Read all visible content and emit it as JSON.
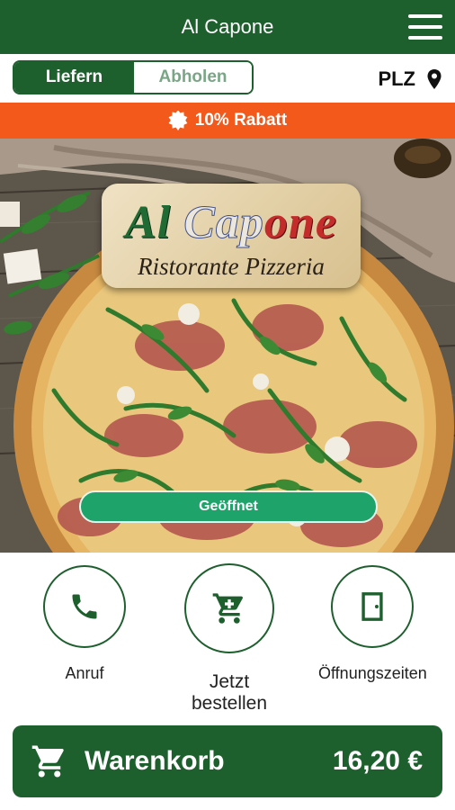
{
  "header": {
    "title": "Al Capone",
    "menu_icon": "hamburger-menu-icon"
  },
  "mode_toggle": {
    "options": [
      "Liefern",
      "Abholen"
    ],
    "selected": "Liefern"
  },
  "postcode": {
    "label": "PLZ",
    "icon": "location-pin-icon"
  },
  "promo": {
    "text": "10% Rabatt",
    "icon": "badge-icon",
    "color": "#f4591c"
  },
  "logo": {
    "word_1": "Al",
    "word_2": "Cap",
    "word_3": "one",
    "subtitle": "Ristorante Pizzeria"
  },
  "status": {
    "text": "Geöffnet",
    "color": "#1ea36a"
  },
  "actions": [
    {
      "label": "Anruf",
      "icon": "phone-icon"
    },
    {
      "label": "Jetzt bestellen",
      "icon": "cart-icon"
    },
    {
      "label": "Öffnungszeiten",
      "icon": "door-icon"
    }
  ],
  "cart": {
    "label": "Warenkorb",
    "total": "16,20 €",
    "icon": "cart-icon"
  },
  "colors": {
    "primary": "#1e5f2e",
    "accent": "#f4591c",
    "open": "#1ea36a"
  }
}
